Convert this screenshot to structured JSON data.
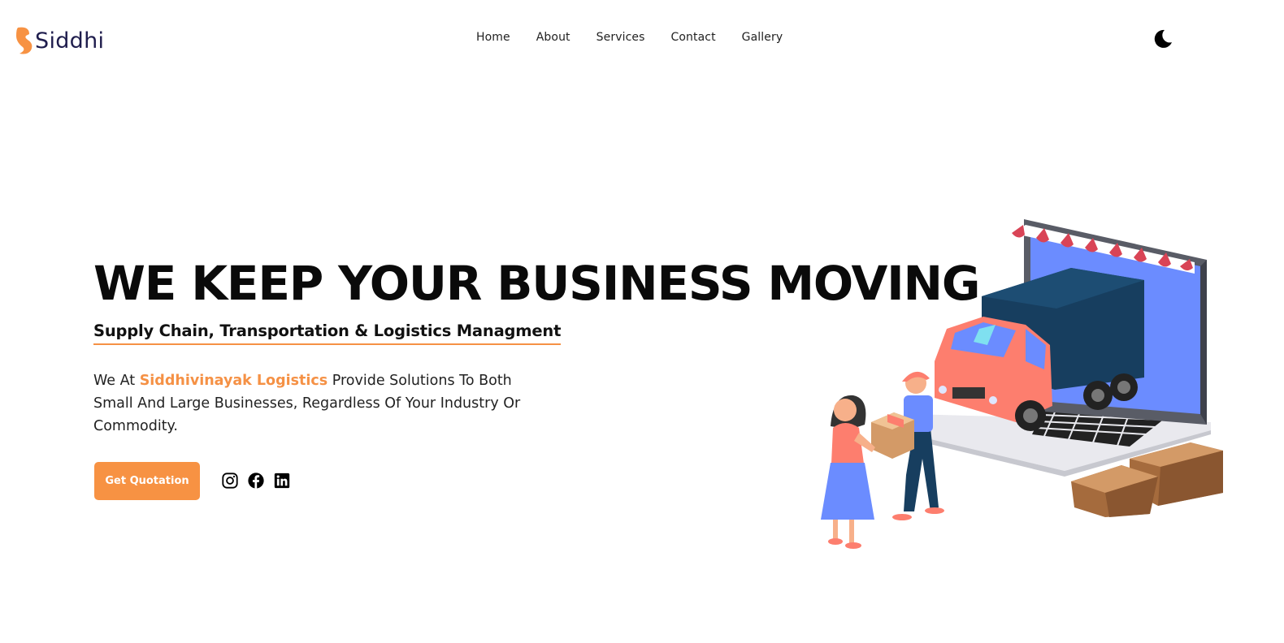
{
  "brand": {
    "name": "Siddhi",
    "accent_color": "#f59145",
    "logo_icon": "s-logo-icon"
  },
  "nav": {
    "items": [
      "Home",
      "About",
      "Services",
      "Contact",
      "Gallery"
    ]
  },
  "theme_toggle": {
    "icon": "moon-icon"
  },
  "hero": {
    "title": "WE KEEP YOUR BUSINESS MOVING",
    "subtitle": "Supply Chain, Transportation & Logistics Managment",
    "description_prefix": "We At ",
    "description_brand": "Siddhivinayak Logistics",
    "description_suffix": " Provide Solutions To Both Small And Large Businesses, Regardless Of Your Industry Or Commodity.",
    "cta_label": "Get Quotation"
  },
  "socials": [
    {
      "icon": "instagram-icon"
    },
    {
      "icon": "facebook-icon"
    },
    {
      "icon": "linkedin-icon"
    }
  ],
  "illustration": {
    "icon": "delivery-truck-laptop-illustration"
  }
}
